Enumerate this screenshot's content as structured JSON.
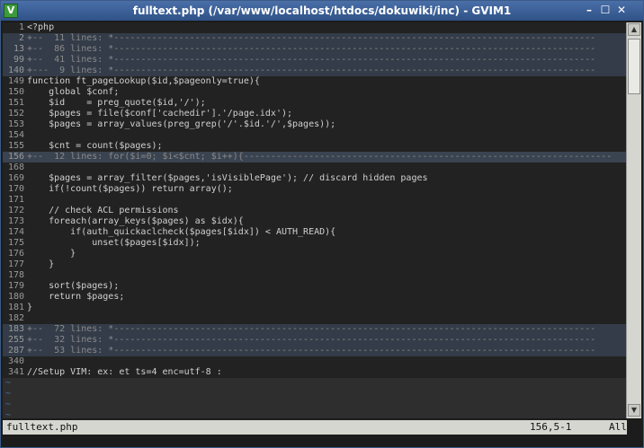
{
  "window": {
    "title": "fulltext.php (/var/www/localhost/htdocs/dokuwiki/inc) - GVIM1"
  },
  "colors": {
    "titlebar": "#2f5287",
    "background": "#222222",
    "fold_line": "#333c48",
    "line_number": "#9a9a9a"
  },
  "lines": [
    {
      "num": "1",
      "text": "<?php",
      "type": "code"
    },
    {
      "num": "2",
      "text": "+--  11 lines: *-----------------------------------------------------------------------------------------",
      "type": "fold"
    },
    {
      "num": "13",
      "text": "+--  86 lines: *-----------------------------------------------------------------------------------------",
      "type": "fold"
    },
    {
      "num": "99",
      "text": "+--  41 lines: *-----------------------------------------------------------------------------------------",
      "type": "fold"
    },
    {
      "num": "140",
      "text": "+---  9 lines: *-----------------------------------------------------------------------------------------",
      "type": "fold"
    },
    {
      "num": "149",
      "text": "function ft_pageLookup($id,$pageonly=true){",
      "type": "code"
    },
    {
      "num": "150",
      "text": "    global $conf;",
      "type": "code"
    },
    {
      "num": "151",
      "text": "    $id    = preg_quote($id,'/');",
      "type": "code"
    },
    {
      "num": "152",
      "text": "    $pages = file($conf['cachedir'].'/page.idx');",
      "type": "code"
    },
    {
      "num": "153",
      "text": "    $pages = array_values(preg_grep('/'.$id.'/',$pages));",
      "type": "code"
    },
    {
      "num": "154",
      "text": "",
      "type": "code"
    },
    {
      "num": "155",
      "text": "    $cnt = count($pages);",
      "type": "code"
    },
    {
      "num": "156",
      "text": "+--  12 lines: for($i=0; $i<$cnt; $i++){--------------------------------------------------------------------",
      "type": "cursor"
    },
    {
      "num": "168",
      "text": "",
      "type": "code"
    },
    {
      "num": "169",
      "text": "    $pages = array_filter($pages,'isVisiblePage'); // discard hidden pages",
      "type": "code"
    },
    {
      "num": "170",
      "text": "    if(!count($pages)) return array();",
      "type": "code"
    },
    {
      "num": "171",
      "text": "",
      "type": "code"
    },
    {
      "num": "172",
      "text": "    // check ACL permissions",
      "type": "code"
    },
    {
      "num": "173",
      "text": "    foreach(array_keys($pages) as $idx){",
      "type": "code"
    },
    {
      "num": "174",
      "text": "        if(auth_quickaclcheck($pages[$idx]) < AUTH_READ){",
      "type": "code"
    },
    {
      "num": "175",
      "text": "            unset($pages[$idx]);",
      "type": "code"
    },
    {
      "num": "176",
      "text": "        }",
      "type": "code"
    },
    {
      "num": "177",
      "text": "    }",
      "type": "code"
    },
    {
      "num": "178",
      "text": "",
      "type": "code"
    },
    {
      "num": "179",
      "text": "    sort($pages);",
      "type": "code"
    },
    {
      "num": "180",
      "text": "    return $pages;",
      "type": "code"
    },
    {
      "num": "181",
      "text": "}",
      "type": "code"
    },
    {
      "num": "182",
      "text": "",
      "type": "code"
    },
    {
      "num": "183",
      "text": "+--  72 lines: *-----------------------------------------------------------------------------------------",
      "type": "fold"
    },
    {
      "num": "255",
      "text": "+--  32 lines: *-----------------------------------------------------------------------------------------",
      "type": "fold"
    },
    {
      "num": "287",
      "text": "+--  53 lines: *-----------------------------------------------------------------------------------------",
      "type": "fold"
    },
    {
      "num": "340",
      "text": "",
      "type": "code"
    },
    {
      "num": "341",
      "text": "//Setup VIM: ex: et ts=4 enc=utf-8 :",
      "type": "code"
    }
  ],
  "tilde_count": 4,
  "tilde_char": "~",
  "status": {
    "filename": "fulltext.php",
    "position": "156,5-1",
    "percent": "All"
  },
  "icons": {
    "app": "gvim-icon",
    "minimize": "minimize-icon",
    "maximize": "maximize-icon",
    "close": "close-icon"
  }
}
